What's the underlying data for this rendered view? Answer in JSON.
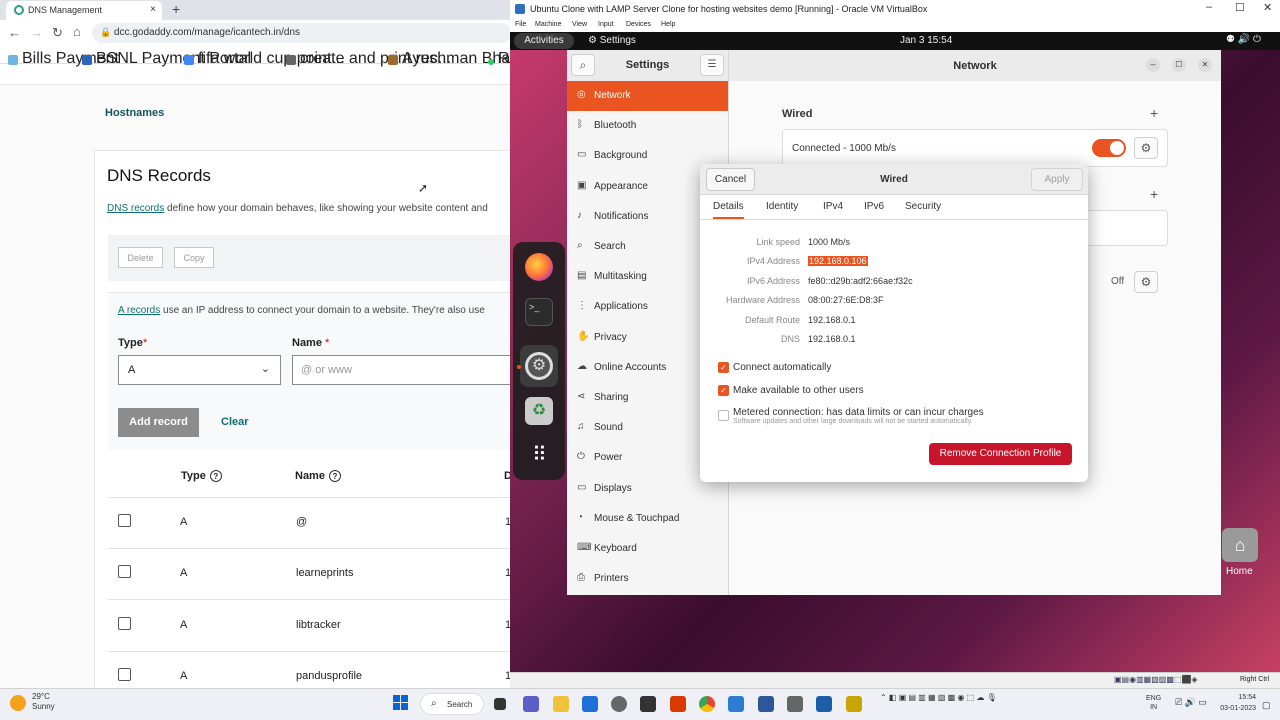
{
  "browser": {
    "tab_title": "DNS Management",
    "tab_close": "×",
    "new_tab": "+",
    "url": "dcc.godaddy.com/manage/icantech.in/dns",
    "nav_back": "←",
    "nav_forward": "→",
    "nav_reload": "↻",
    "nav_home": "⌂",
    "bookmarks": [
      "Bills Payment",
      "BSNL Payment Portal",
      "fifa world cup point...",
      "create and print rec...",
      "Ayushman Bharath...",
      "Ra"
    ]
  },
  "dns_page": {
    "hostnames_link": "Hostnames",
    "title": "DNS Records",
    "desc_link": "DNS records",
    "desc_text": " define how your domain behaves, like showing your website content and",
    "delete_label": "Delete",
    "copy_label": "Copy",
    "a_records_link": "A records",
    "a_records_text": " use an IP address to connect your domain to a website. They're also use",
    "type_label": "Type",
    "name_label": "Name",
    "required_mark": "*",
    "type_value": "A",
    "name_placeholder": "@ or www",
    "add_record_label": "Add record",
    "clear_label": "Clear",
    "table_headers": {
      "type": "Type",
      "name": "Name",
      "data": "D"
    },
    "help_glyph": "?",
    "rows": [
      {
        "type": "A",
        "name": "@",
        "ttl": "1"
      },
      {
        "type": "A",
        "name": "learneprints",
        "ttl": "1"
      },
      {
        "type": "A",
        "name": "libtracker",
        "ttl": "1"
      },
      {
        "type": "A",
        "name": "pandusprofile",
        "ttl": "1"
      }
    ]
  },
  "vbox": {
    "title": "Ubuntu Clone with LAMP Server Clone for hosting websites demo [Running] - Oracle VM VirtualBox",
    "menu": [
      "File",
      "Machine",
      "View",
      "Input",
      "Devices",
      "Help"
    ],
    "status_host_key": "Right Ctrl"
  },
  "ubuntu": {
    "activities": "Activities",
    "settings_app": "Settings",
    "datetime": "Jan 3  15:54",
    "home_label": "Home"
  },
  "settings": {
    "title": "Settings",
    "panel_title": "Network",
    "sidebar": [
      {
        "label": "Network",
        "icon": "network-icon",
        "glyph": "◎"
      },
      {
        "label": "Bluetooth",
        "icon": "bluetooth-icon",
        "glyph": "ᛒ"
      },
      {
        "label": "Background",
        "icon": "background-icon",
        "glyph": "▭"
      },
      {
        "label": "Appearance",
        "icon": "appearance-icon",
        "glyph": "▣"
      },
      {
        "label": "Notifications",
        "icon": "bell-icon",
        "glyph": "♪"
      },
      {
        "label": "Search",
        "icon": "search-icon",
        "glyph": "⌕"
      },
      {
        "label": "Multitasking",
        "icon": "multitasking-icon",
        "glyph": "▤"
      },
      {
        "label": "Applications",
        "icon": "applications-icon",
        "glyph": "⋮"
      },
      {
        "label": "Privacy",
        "icon": "privacy-icon",
        "glyph": "✋"
      },
      {
        "label": "Online Accounts",
        "icon": "cloud-icon",
        "glyph": "☁"
      },
      {
        "label": "Sharing",
        "icon": "sharing-icon",
        "glyph": "⋖"
      },
      {
        "label": "Sound",
        "icon": "sound-icon",
        "glyph": "♫"
      },
      {
        "label": "Power",
        "icon": "power-icon",
        "glyph": "⏻"
      },
      {
        "label": "Displays",
        "icon": "displays-icon",
        "glyph": "▭"
      },
      {
        "label": "Mouse & Touchpad",
        "icon": "mouse-icon",
        "glyph": "◔"
      },
      {
        "label": "Keyboard",
        "icon": "keyboard-icon",
        "glyph": "⌨"
      },
      {
        "label": "Printers",
        "icon": "printer-icon",
        "glyph": "⎙"
      }
    ],
    "wired_heading": "Wired",
    "connected_label": "Connected - 1000 Mb/s",
    "off_label": "Off"
  },
  "dialog": {
    "title": "Wired",
    "cancel": "Cancel",
    "apply": "Apply",
    "tabs": [
      "Details",
      "Identity",
      "IPv4",
      "IPv6",
      "Security"
    ],
    "details": [
      {
        "key": "Link speed",
        "value": "1000 Mb/s"
      },
      {
        "key": "IPv4 Address",
        "value": "192.168.0.106"
      },
      {
        "key": "IPv6 Address",
        "value": "fe80::d29b:adf2:66ae:f32c"
      },
      {
        "key": "Hardware Address",
        "value": "08:00:27:6E:D8:3F"
      },
      {
        "key": "Default Route",
        "value": "192.168.0.1"
      },
      {
        "key": "DNS",
        "value": "192.168.0.1"
      }
    ],
    "connect_auto": "Connect automatically",
    "available_all": "Make available to other users",
    "metered": "Metered connection: has data limits or can incur charges",
    "metered_sub": "Software updates and other large downloads will not be started automatically.",
    "remove_profile": "Remove Connection Profile",
    "accent": "#e95420",
    "danger": "#c7162b"
  },
  "taskbar": {
    "temp": "29°C",
    "weather": "Sunny",
    "search": "Search",
    "lang": "ENG",
    "region": "IN",
    "time": "15:54",
    "date": "03-01-2023"
  }
}
